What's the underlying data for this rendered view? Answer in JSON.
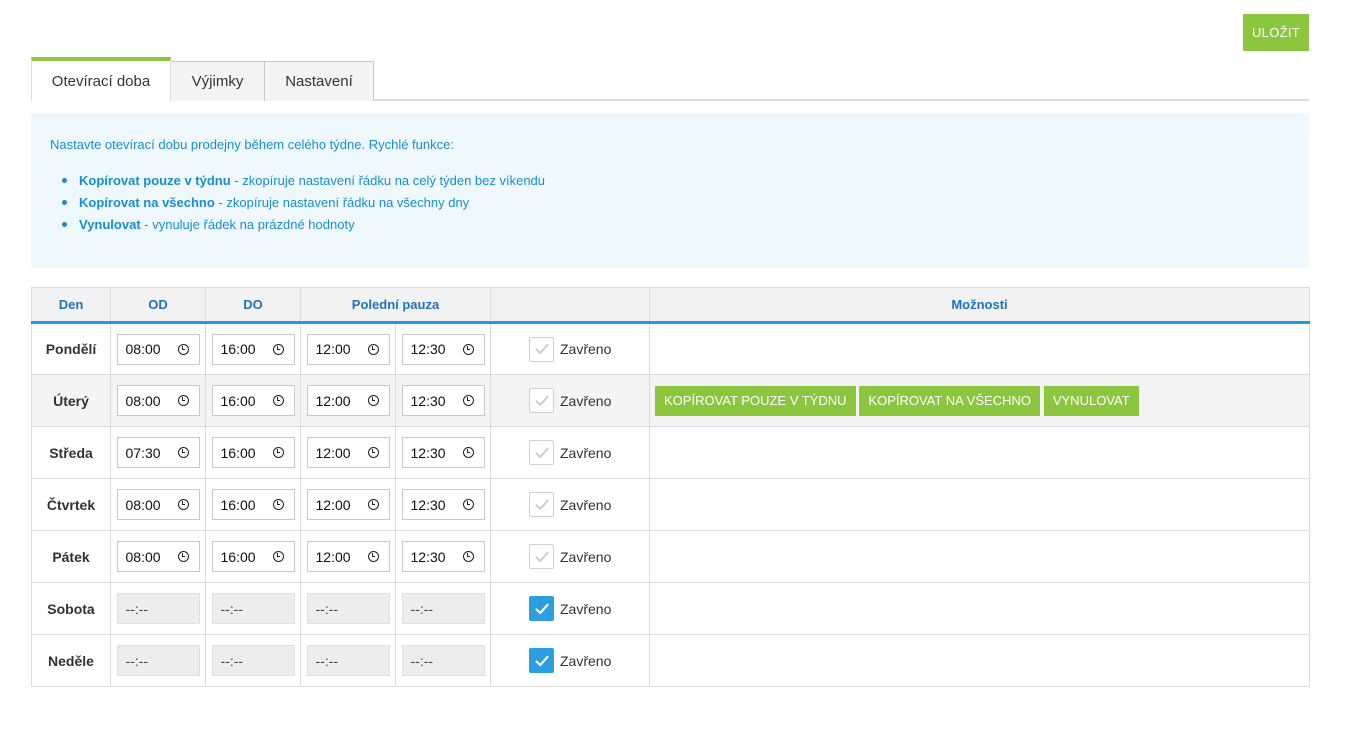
{
  "header": {
    "save_label": "ULOŽIT"
  },
  "tabs": [
    {
      "label": "Otevírací doba",
      "active": true
    },
    {
      "label": "Výjimky",
      "active": false
    },
    {
      "label": "Nastavení",
      "active": false
    }
  ],
  "info": {
    "intro": "Nastavte otevírací dobu prodejny během celého týdne. Rychlé funkce:",
    "items": [
      {
        "bold": "Kopírovat pouze v týdnu",
        "text": " - zkopíruje nastavení řádku na celý týden bez víkendu"
      },
      {
        "bold": "Kopírovat na všechno",
        "text": " - zkopíruje nastavení řádku na všechny dny"
      },
      {
        "bold": "Vynulovat",
        "text": " - vynuluje řádek na prázdné hodnoty"
      }
    ]
  },
  "table": {
    "headers": {
      "day": "Den",
      "from": "OD",
      "to": "DO",
      "pause": "Polední pauza",
      "closed": "",
      "options": "Možnosti"
    },
    "closed_label": "Zavřeno",
    "rows": [
      {
        "day": "Pondělí",
        "from": "08:00",
        "to": "16:00",
        "pause_from": "12:00",
        "pause_to": "12:30",
        "closed": false
      },
      {
        "day": "Úterý",
        "from": "08:00",
        "to": "16:00",
        "pause_from": "12:00",
        "pause_to": "12:30",
        "closed": false
      },
      {
        "day": "Středa",
        "from": "07:30",
        "to": "16:00",
        "pause_from": "12:00",
        "pause_to": "12:30",
        "closed": false
      },
      {
        "day": "Čtvrtek",
        "from": "08:00",
        "to": "16:00",
        "pause_from": "12:00",
        "pause_to": "12:30",
        "closed": false
      },
      {
        "day": "Pátek",
        "from": "08:00",
        "to": "16:00",
        "pause_from": "12:00",
        "pause_to": "12:30",
        "closed": false
      },
      {
        "day": "Sobota",
        "from": "--:--",
        "to": "--:--",
        "pause_from": "--:--",
        "pause_to": "--:--",
        "closed": true
      },
      {
        "day": "Neděle",
        "from": "--:--",
        "to": "--:--",
        "pause_from": "--:--",
        "pause_to": "--:--",
        "closed": true
      }
    ],
    "row_actions": {
      "copy_weekdays": "KOPÍROVAT POUZE V TÝDNU",
      "copy_all": "KOPÍROVAT NA VŠECHNO",
      "reset": "VYNULOVAT"
    }
  },
  "colors": {
    "accent_green": "#8cc63f",
    "accent_blue": "#1a9ee0",
    "info_bg": "#eff8fd"
  }
}
